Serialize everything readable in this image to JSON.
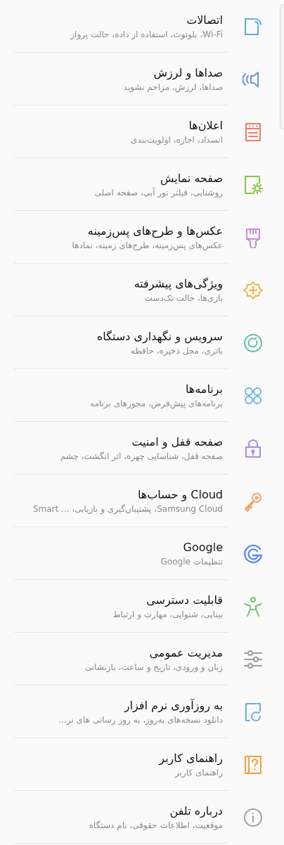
{
  "settings": [
    {
      "title": "اتصالات",
      "subtitle": "Wi-Fi، بلوتوث، استفاده از داده، حالت پرواز",
      "kind": "connections",
      "color": "#5aa9e0"
    },
    {
      "title": "صداها و لرزش",
      "subtitle": "صداها، لرزش، مزاحم نشوید",
      "kind": "sound",
      "color": "#6b8fe8"
    },
    {
      "title": "اعلان‌ها",
      "subtitle": "انسداد، اجازه، اولویت‌بندی",
      "kind": "notifications",
      "color": "#f07a6a"
    },
    {
      "title": "صفحه نمایش",
      "subtitle": "روشنایی، فیلتر نور آبی، صفحه اصلی",
      "kind": "display",
      "color": "#8bc34a"
    },
    {
      "title": "عکس‌ها و طرح‌های پس‌زمینه",
      "subtitle": "عکس‌های پس‌زمینه، طرح‌های زمینه، نمادها",
      "kind": "wallpaper",
      "color": "#c98bd6"
    },
    {
      "title": "ویژگی‌های پیشرفته",
      "subtitle": "بازی‌ها، حالت تک‌دست",
      "kind": "advanced",
      "color": "#f0b545"
    },
    {
      "title": "سرویس و نگهداری دستگاه",
      "subtitle": "باتری، محل ذخیره، حافظه",
      "kind": "maintenance",
      "color": "#5cc4a8"
    },
    {
      "title": "برنامه‌ها",
      "subtitle": "برنامه‌های پیش‌فرض، مجوزهای برنامه",
      "kind": "apps",
      "color": "#6bb5e6"
    },
    {
      "title": "صفحه قفل و امنیت",
      "subtitle": "صفحه قفل، شناسایی چهره، اثر انگشت، چشم",
      "kind": "lock",
      "color": "#a98be0"
    },
    {
      "title": "Cloud و حساب‌ها",
      "subtitle": "Samsung Cloud، پشتیبان‌گیری و بازیابی، ... Smart",
      "kind": "key",
      "color": "#f5a060"
    },
    {
      "title": "Google",
      "subtitle": "تنظیمات Google",
      "kind": "google",
      "color": "#5b8def"
    },
    {
      "title": "قابلیت دسترسی",
      "subtitle": "بینایی، شنوایی، مهارت و ارتباط",
      "kind": "accessibility",
      "color": "#7cc47f"
    },
    {
      "title": "مدیریت عمومی",
      "subtitle": "زبان و ورودی، تاریخ و ساعت، بازنشانی",
      "kind": "sliders",
      "color": "#9aa0a6"
    },
    {
      "title": "به روزآوری نرم افزار",
      "subtitle": "دانلود نسخه‌های به‌روز، به روز رسانی های نر...",
      "kind": "update",
      "color": "#6aaee8"
    },
    {
      "title": "راهنمای کاربر",
      "subtitle": "راهنمای کاربر",
      "kind": "manual",
      "color": "#f0a040"
    },
    {
      "title": "درباره تلفن",
      "subtitle": "موقعیت، اطلاعات حقوقی، نام دستگاه",
      "kind": "info",
      "color": "#a0a4a8"
    }
  ]
}
